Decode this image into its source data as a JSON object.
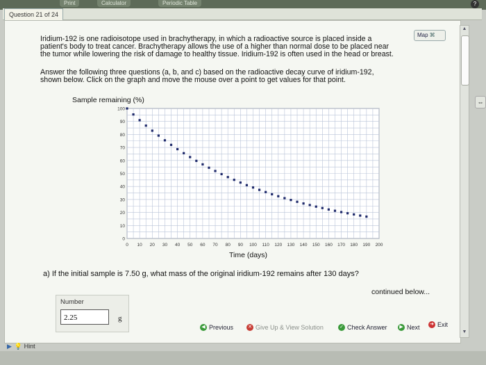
{
  "toolbar": {
    "print": "Print",
    "calculator": "Calculator",
    "periodic_table": "Periodic Table"
  },
  "question_header": "Question 21 of 24",
  "intro": [
    "Iridium-192 is one radioisotope used in brachytherapy, in which a radioactive source is placed inside a",
    "patient's body to treat cancer. Brachytherapy allows the use of a higher than normal dose to be placed near",
    "the tumor while lowering the risk of damage to healthy tissue. Iridium-192 is often used in the head or breast."
  ],
  "instructions": [
    "Answer the following three questions (a, b, and c) based on the radioactive decay curve of iridium-192,",
    "shown below. Click on the graph and move the mouse over a point to get values for that point."
  ],
  "map_label": "Map",
  "chart_data": {
    "type": "scatter",
    "xlabel": "Time (days)",
    "ylabel": "Sample remaining (%)",
    "xlim": [
      0,
      200
    ],
    "ylim": [
      0,
      100
    ],
    "grid": true,
    "x_ticks": [
      0,
      10,
      20,
      30,
      40,
      50,
      60,
      70,
      80,
      90,
      100,
      110,
      120,
      130,
      140,
      150,
      160,
      170,
      180,
      190,
      200
    ],
    "y_ticks": [
      0,
      10,
      20,
      30,
      40,
      50,
      60,
      70,
      80,
      90,
      100
    ],
    "series": [
      {
        "color": "#1f2a6b",
        "x": [
          0,
          5,
          10,
          15,
          20,
          25,
          30,
          35,
          40,
          45,
          50,
          55,
          60,
          65,
          70,
          75,
          80,
          85,
          90,
          95,
          100,
          105,
          110,
          115,
          120,
          125,
          130,
          135,
          140,
          145,
          150,
          155,
          160,
          165,
          170,
          175,
          180,
          185,
          190
        ],
        "y": [
          100,
          95.4,
          91.0,
          86.8,
          82.9,
          79.1,
          75.5,
          72.0,
          68.7,
          65.6,
          62.6,
          59.7,
          57.0,
          54.4,
          51.9,
          49.5,
          47.2,
          45.1,
          43.0,
          41.0,
          39.2,
          37.4,
          35.7,
          34.0,
          32.5,
          31.0,
          29.6,
          28.2,
          26.9,
          25.7,
          24.5,
          23.4,
          22.3,
          21.3,
          20.3,
          19.4,
          18.5,
          17.6,
          16.8
        ]
      }
    ]
  },
  "question_a": "a) If the initial sample is 7.50 g, what mass of the original iridium-192 remains after 130 days?",
  "continued": "continued below...",
  "number_label": "Number",
  "answer_value": "2.25",
  "answer_unit": "g",
  "nav": {
    "previous": "Previous",
    "give_up": "Give Up & View Solution",
    "check_answer": "Check Answer",
    "next": "Next",
    "exit": "Exit"
  },
  "hint_label": "Hint"
}
